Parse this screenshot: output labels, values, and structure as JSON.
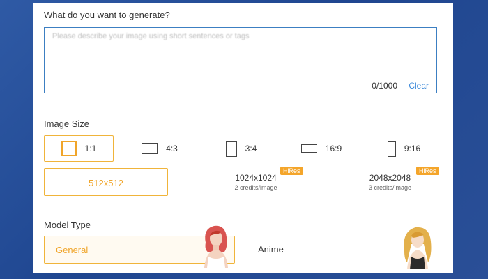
{
  "prompt": {
    "label": "What do you want to generate?",
    "placeholder": "Please describe your image using short sentences or tags",
    "counter": "0/1000",
    "clear_label": "Clear"
  },
  "image_size": {
    "label": "Image Size",
    "ratios": [
      {
        "label": "1:1",
        "icon": "square-ratio-icon",
        "selected": true
      },
      {
        "label": "4:3",
        "icon": "landscape-ratio-icon",
        "selected": false
      },
      {
        "label": "3:4",
        "icon": "portrait-ratio-icon",
        "selected": false
      },
      {
        "label": "16:9",
        "icon": "wide-ratio-icon",
        "selected": false
      },
      {
        "label": "9:16",
        "icon": "tall-ratio-icon",
        "selected": false
      }
    ],
    "resolutions": [
      {
        "label": "512x512",
        "selected": true
      },
      {
        "label": "1024x1024",
        "credits": "2 credits/image",
        "badge": "HiRes"
      },
      {
        "label": "2048x2048",
        "credits": "3 credits/image",
        "badge": "HiRes"
      }
    ]
  },
  "model_type": {
    "label": "Model Type",
    "options": [
      {
        "label": "General",
        "selected": true,
        "icon": "general-model-avatar-icon"
      },
      {
        "label": "Anime",
        "selected": false,
        "icon": "anime-model-avatar-icon"
      }
    ]
  },
  "colors": {
    "accent": "#f0a52a",
    "link": "#3a88d9",
    "focus_border": "#3c7fc2"
  }
}
